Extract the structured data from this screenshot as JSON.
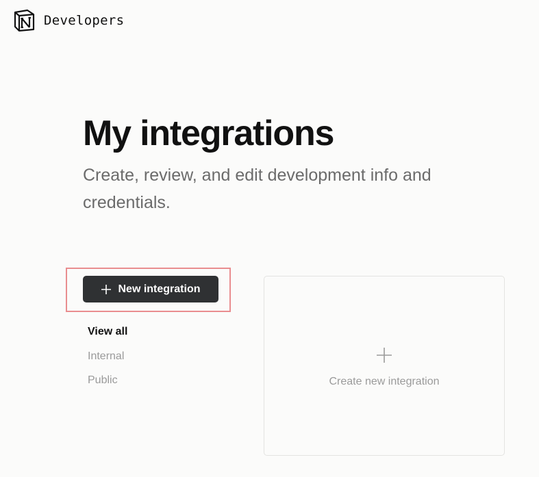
{
  "header": {
    "logo_icon": "notion-logo-icon",
    "brand": "Developers"
  },
  "main": {
    "title": "My integrations",
    "subtitle": "Create, review, and edit development info and credentials."
  },
  "actions": {
    "new_integration_label": "New integration",
    "new_integration_icon": "plus-icon",
    "button_color": "#2f3133",
    "highlight_color": "#e98d8f"
  },
  "filters": {
    "items": [
      {
        "label": "View all",
        "active": true
      },
      {
        "label": "Internal",
        "active": false
      },
      {
        "label": "Public",
        "active": false
      }
    ]
  },
  "card": {
    "icon": "plus-icon",
    "label": "Create new integration"
  }
}
